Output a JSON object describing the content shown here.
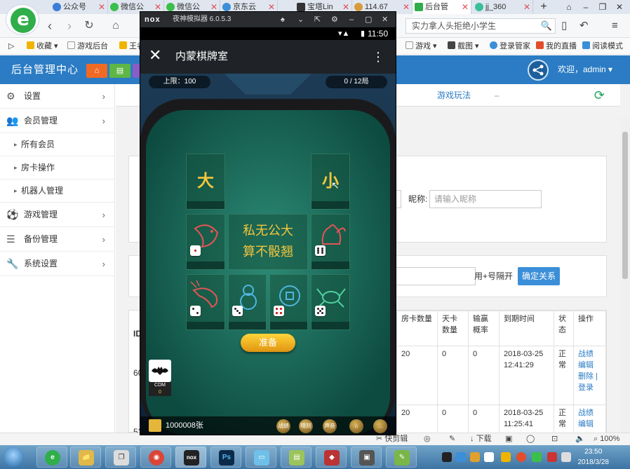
{
  "browser": {
    "tabs": [
      {
        "label": "公众号",
        "color": "#3b7dd8"
      },
      {
        "label": "微信公",
        "color": "#3bbf4a"
      },
      {
        "label": "微信公",
        "color": "#3bbf4a"
      },
      {
        "label": "京东云",
        "color": "#3b8fd8"
      },
      {
        "label": "宝塔Lin",
        "color": "#333333"
      },
      {
        "label": "114.67",
        "color": "#d89a3b"
      },
      {
        "label": "后台管",
        "color": "#2fae4a"
      },
      {
        "label": "jj_360",
        "color": "#3bbf9a"
      }
    ],
    "new_tab": "+",
    "search_box": "实力拿人头拒绝小学生",
    "bookmarks": [
      "收藏",
      "游戏后台",
      "王者",
      "游戏",
      "截图",
      "登录管家",
      "我的直播",
      "阅读模式"
    ]
  },
  "admin": {
    "brand": "后台管理中心",
    "welcome": "欢迎，admin ▾",
    "sidebar": {
      "items": [
        {
          "label": "设置",
          "icon": "gears-icon"
        },
        {
          "label": "会员管理",
          "icon": "users-icon"
        },
        {
          "label": "游戏管理",
          "icon": "soccer-icon"
        },
        {
          "label": "备份管理",
          "icon": "database-icon"
        },
        {
          "label": "系统设置",
          "icon": "wrench-icon"
        }
      ],
      "subitems": [
        "所有会员",
        "房卡操作",
        "机器人管理"
      ]
    },
    "top_tab": "游戏玩法",
    "nickname_label": "昵称:",
    "nickname_placeholder": "请输入昵称",
    "relation_hint": "用+号隔开",
    "confirm_button": "确定关系",
    "table": {
      "id_header": "ID",
      "headers": [
        "房卡数量",
        "天卡数量",
        "输赢概率",
        "到期时间",
        "状态",
        "操作"
      ],
      "rows": [
        {
          "id": "60",
          "cards": "20",
          "day": "0",
          "prob": "0",
          "expire": "2018-03-25 12:41:29",
          "status": "正常",
          "actions": [
            "战绩",
            "编辑",
            "删除 |",
            "登录"
          ]
        },
        {
          "id": "52",
          "cards": "20",
          "day": "0",
          "prob": "0",
          "expire": "2018-03-25 11:25:41",
          "status": "正常",
          "actions": [
            "战绩",
            "编辑"
          ]
        }
      ]
    }
  },
  "emulator": {
    "brand": "nox",
    "title": "夜神模拟器 6.0.5.3",
    "clock": "11:50",
    "app_title": "内蒙棋牌室",
    "limit": "上限：100",
    "rounds": "0 / 12局",
    "big": "大",
    "small": "小",
    "center_line1": "私无公大",
    "center_line2": "算不骰翘",
    "ready": "准备",
    "cdm_label": "CDM",
    "cdm_value": "0",
    "coins": "1000008张",
    "bottom_buttons": [
      "战绩",
      "规则",
      "声音"
    ]
  },
  "statusbar": {
    "clip": "快剪辑",
    "download": "下载",
    "zoom": "100%"
  },
  "taskbar": {
    "time": "23:50",
    "date": "2018/3/28",
    "apps": [
      "e",
      "📁",
      "❐",
      "◉",
      "nox",
      "Ps",
      "▭",
      "▤",
      "◆",
      "▣",
      "✎"
    ]
  }
}
